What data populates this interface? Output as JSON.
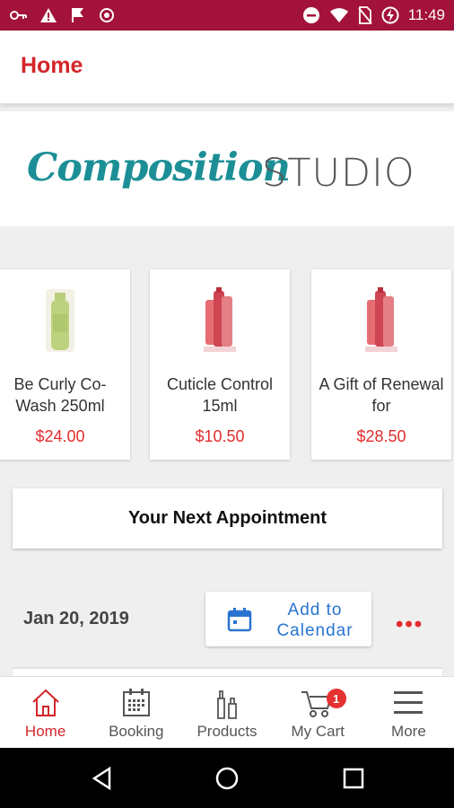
{
  "status_bar": {
    "time": "11:49"
  },
  "header": {
    "title": "Home"
  },
  "logo": {
    "script_text": "Composition",
    "studio_text": "STUDIO"
  },
  "products": [
    {
      "name": "Be Curly Co-Wash 250ml",
      "price": "$24.00"
    },
    {
      "name": "Cuticle Control 15ml",
      "price": "$10.50"
    },
    {
      "name": "A Gift of Renewal for",
      "price": "$28.50"
    }
  ],
  "appointment": {
    "button_label": "Your Next Appointment",
    "date": "Jan 20, 2019",
    "calendar_label": "Add to Calendar",
    "more_label": "•••"
  },
  "bottom_nav": {
    "items": [
      {
        "label": "Home",
        "icon": "home-icon"
      },
      {
        "label": "Booking",
        "icon": "calendar-grid-icon"
      },
      {
        "label": "Products",
        "icon": "bottles-icon"
      },
      {
        "label": "My Cart",
        "icon": "cart-icon"
      },
      {
        "label": "More",
        "icon": "menu-icon"
      }
    ],
    "cart_badge": "1"
  },
  "colors": {
    "accent": "#d3262a",
    "status_bar": "#a3123a",
    "link_blue": "#2a74d0",
    "logo_teal": "#1c8f96"
  }
}
